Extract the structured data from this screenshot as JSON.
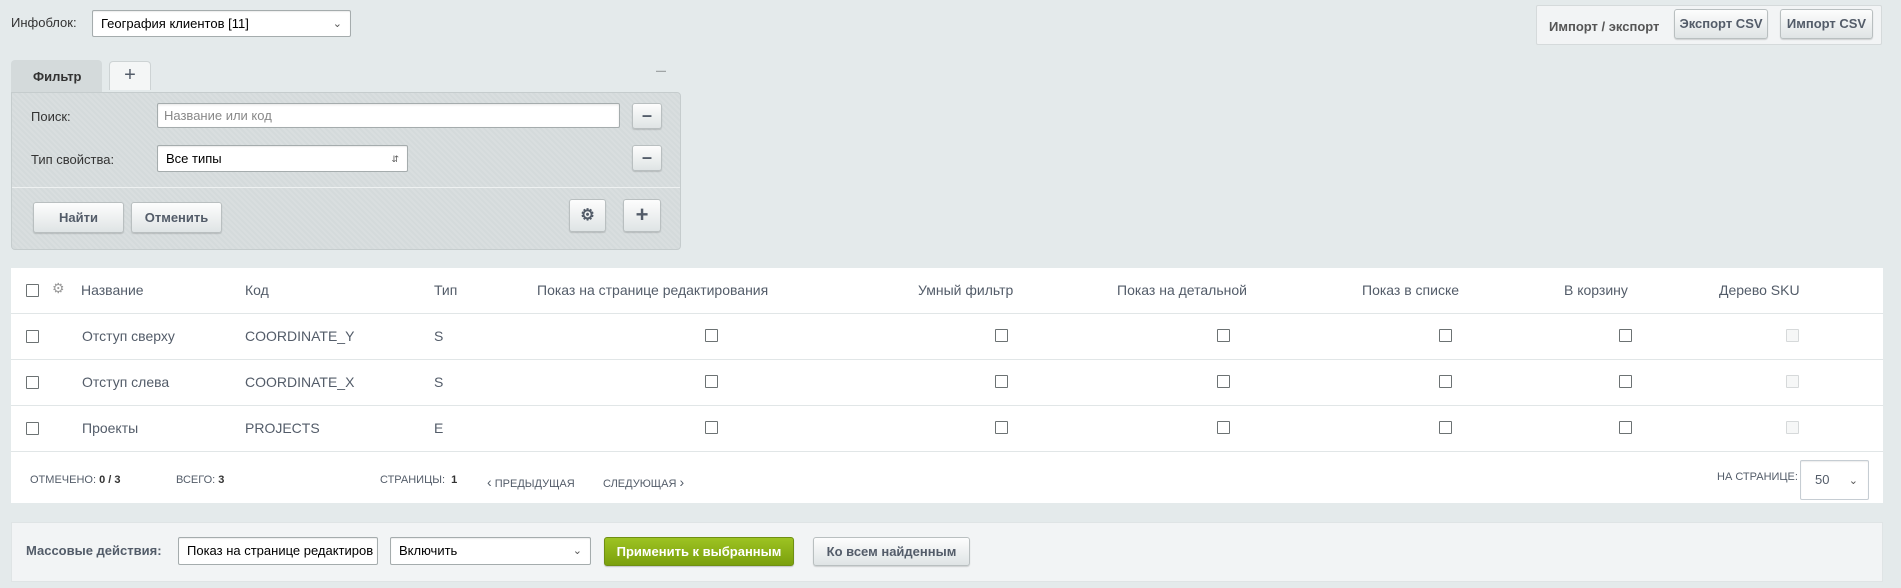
{
  "top": {
    "iblock_label": "Инфоблок:",
    "iblock_value": "География клиентов [11]",
    "import_export_label": "Импорт / экспорт",
    "export_csv": "Экспорт CSV",
    "import_csv": "Импорт CSV"
  },
  "filter": {
    "tab_label": "Фильтр",
    "search_label": "Поиск:",
    "search_placeholder": "Название или код",
    "type_label": "Тип свойства:",
    "type_value": "Все типы",
    "find": "Найти",
    "cancel": "Отменить"
  },
  "table": {
    "headers": [
      "Название",
      "Код",
      "Тип",
      "Показ на странице редактирования",
      "Умный фильтр",
      "Показ на детальной",
      "Показ в списке",
      "В корзину",
      "Дерево SKU"
    ],
    "rows": [
      {
        "name": "Отступ сверху",
        "code": "COORDINATE_Y",
        "type": "S"
      },
      {
        "name": "Отступ слева",
        "code": "COORDINATE_X",
        "type": "S"
      },
      {
        "name": "Проекты",
        "code": "PROJECTS",
        "type": "E"
      }
    ],
    "footer": {
      "selected_label": "ОТМЕЧЕНО:",
      "selected_value": "0 / 3",
      "total_label": "ВСЕГО:",
      "total_value": "3",
      "pages_label": "СТРАНИЦЫ:",
      "pages_value": "1",
      "prev": "ПРЕДЫДУЩАЯ",
      "next": "СЛЕДУЮЩАЯ",
      "per_page_label": "НА СТРАНИЦЕ:",
      "per_page_value": "50"
    }
  },
  "mass": {
    "label": "Массовые действия:",
    "action_value": "Показ на странице редактиров",
    "mode_value": "Включить",
    "apply": "Применить к выбранным",
    "all_found": "Ко всем найденным"
  }
}
